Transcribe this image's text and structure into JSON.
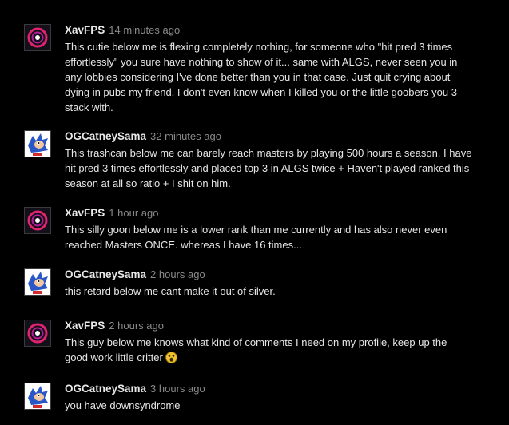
{
  "comments": [
    {
      "author": "XavFPS",
      "time": "14 minutes ago",
      "avatar": "xav-ring-avatar",
      "text": "This cutie below me is flexing completely nothing, for someone who \"hit pred 3 times\neffortlessly\" you sure have nothing to show of it... same with ALGS, never seen you in\nany lobbies considering I've done better than you in that case. Just quit crying about\ndying in pubs my friend, I don't even know when I killed you or the little goobers you 3\nstack with."
    },
    {
      "author": "OGCatneySama",
      "time": "32 minutes ago",
      "avatar": "sonic-avatar",
      "text": "This trashcan below me can barely reach masters by playing 500 hours a season, I have\nhit pred 3 times effortlessly and placed top 3 in ALGS twice + Haven't played ranked this\nseason at all so ratio + I shit on him."
    },
    {
      "author": "XavFPS",
      "time": "1 hour ago",
      "avatar": "xav-ring-avatar",
      "text": "This silly goon below me is a lower rank than me currently and has also never even\nreached Masters ONCE. whereas I have 16 times..."
    },
    {
      "author": "OGCatneySama",
      "time": "2 hours ago",
      "avatar": "sonic-avatar",
      "text": "this retard below me cant make it out of silver."
    },
    {
      "author": "XavFPS",
      "time": "2 hours ago",
      "avatar": "xav-ring-avatar",
      "text": "This guy below me knows what kind of comments I need on my profile, keep up the\ngood work little critter",
      "emote": "surprised-emoticon"
    },
    {
      "author": "OGCatneySama",
      "time": "3 hours ago",
      "avatar": "sonic-avatar",
      "text": "you have downsyndrome"
    }
  ]
}
